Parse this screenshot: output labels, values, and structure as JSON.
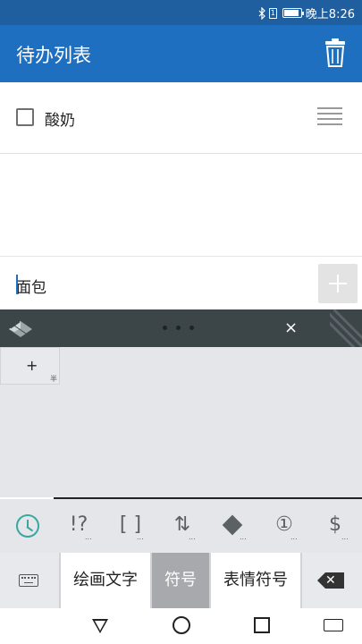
{
  "status_bar": {
    "time": "晚上8:26",
    "sim_label": "1",
    "battery_level": 0.9
  },
  "app_bar": {
    "title": "待办列表"
  },
  "list": {
    "items": [
      {
        "label": "酸奶",
        "checked": false
      }
    ]
  },
  "new_item": {
    "value": "面包"
  },
  "keyboard": {
    "grid_key": {
      "label": "+",
      "sub_label": "半"
    },
    "categories": [
      {
        "icon": "recent-clock",
        "text": ""
      },
      {
        "icon": "punctuation",
        "text": "!?"
      },
      {
        "icon": "brackets",
        "text": "[ ]"
      },
      {
        "icon": "arrows",
        "text": "⇅"
      },
      {
        "icon": "shapes",
        "text": ""
      },
      {
        "icon": "numbers",
        "text": "①"
      },
      {
        "icon": "currency",
        "text": "$"
      }
    ],
    "bottom": {
      "draw_text": "绘画文字",
      "symbols": "符号",
      "emoticons": "表情符号"
    },
    "close": "×"
  },
  "colors": {
    "status_bar": "#1f5fa0",
    "app_bar": "#1f6fc0",
    "accent": "#39a8a0"
  }
}
